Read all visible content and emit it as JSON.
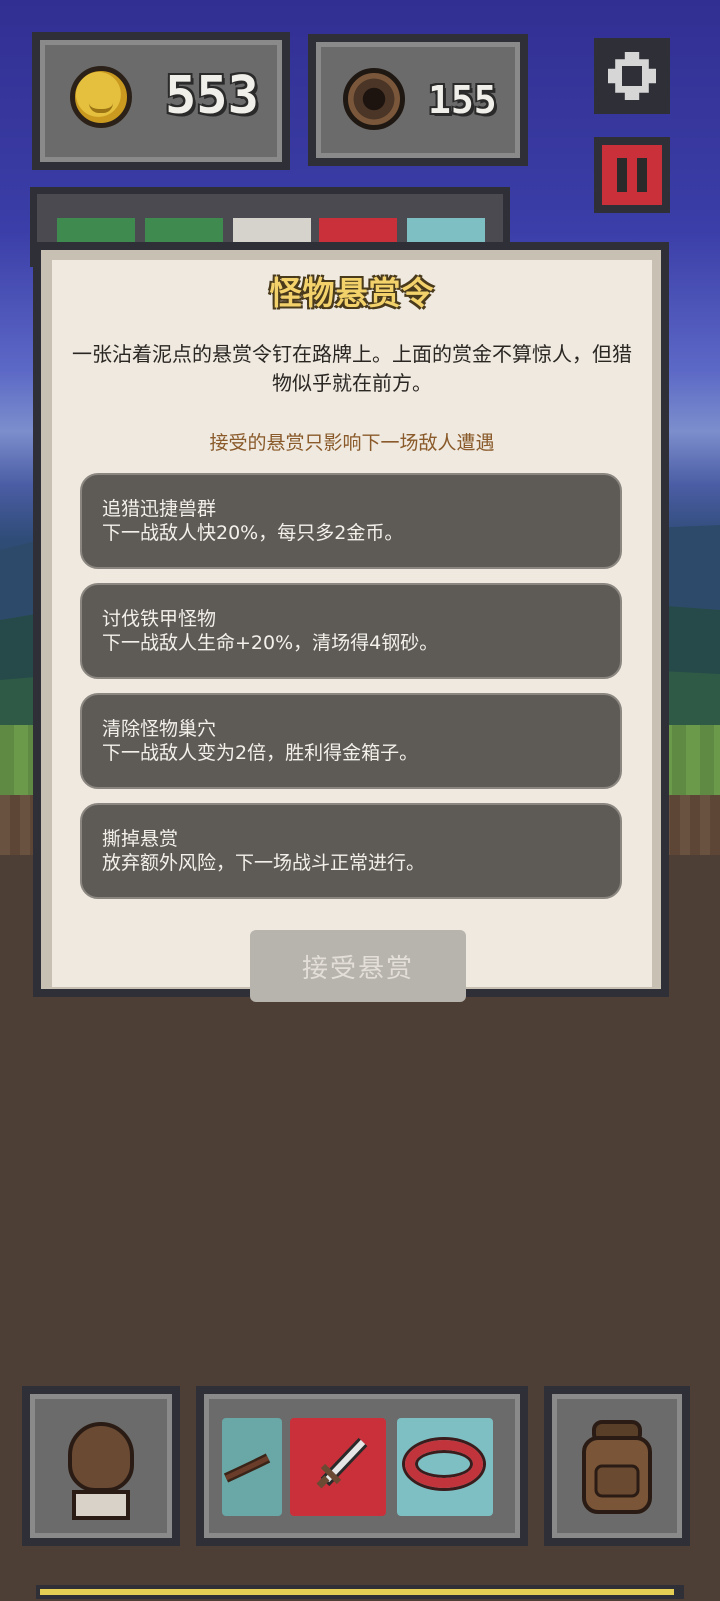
{
  "hud": {
    "gold": "553",
    "wood": "155"
  },
  "modal": {
    "title": "怪物悬赏令",
    "description": "一张沾着泥点的悬赏令钉在路牌上。上面的赏金不算惊人，但猎物似乎就在前方。",
    "note": "接受的悬赏只影响下一场敌人遭遇",
    "options": [
      {
        "title": "追猎迅捷兽群",
        "desc": "下一战敌人快20%，每只多2金币。"
      },
      {
        "title": "讨伐铁甲怪物",
        "desc": "下一战敌人生命+20%，清场得4钢砂。"
      },
      {
        "title": "清除怪物巢穴",
        "desc": "下一战敌人变为2倍，胜利得金箱子。"
      },
      {
        "title": "撕掉悬赏",
        "desc": "放弃额外风险，下一场战斗正常进行。"
      }
    ],
    "accept_label": "接受悬赏"
  },
  "xp_progress": 0.99,
  "colors": {
    "sky": "#3b3ea8",
    "dirt": "#4d3f36",
    "panel_border": "#2f2f38",
    "title_gold": "#f3d26b",
    "note_brown": "#8a5a2a",
    "option_bg": "#5e5b57",
    "pause_red": "#c9303a",
    "xp_yellow": "#e6cf55"
  },
  "icons": [
    "gold-coin-icon",
    "wood-log-icon",
    "gear-icon",
    "pause-icon",
    "hero-avatar-icon",
    "bow-icon",
    "sword-icon",
    "ring-icon",
    "backpack-icon"
  ]
}
